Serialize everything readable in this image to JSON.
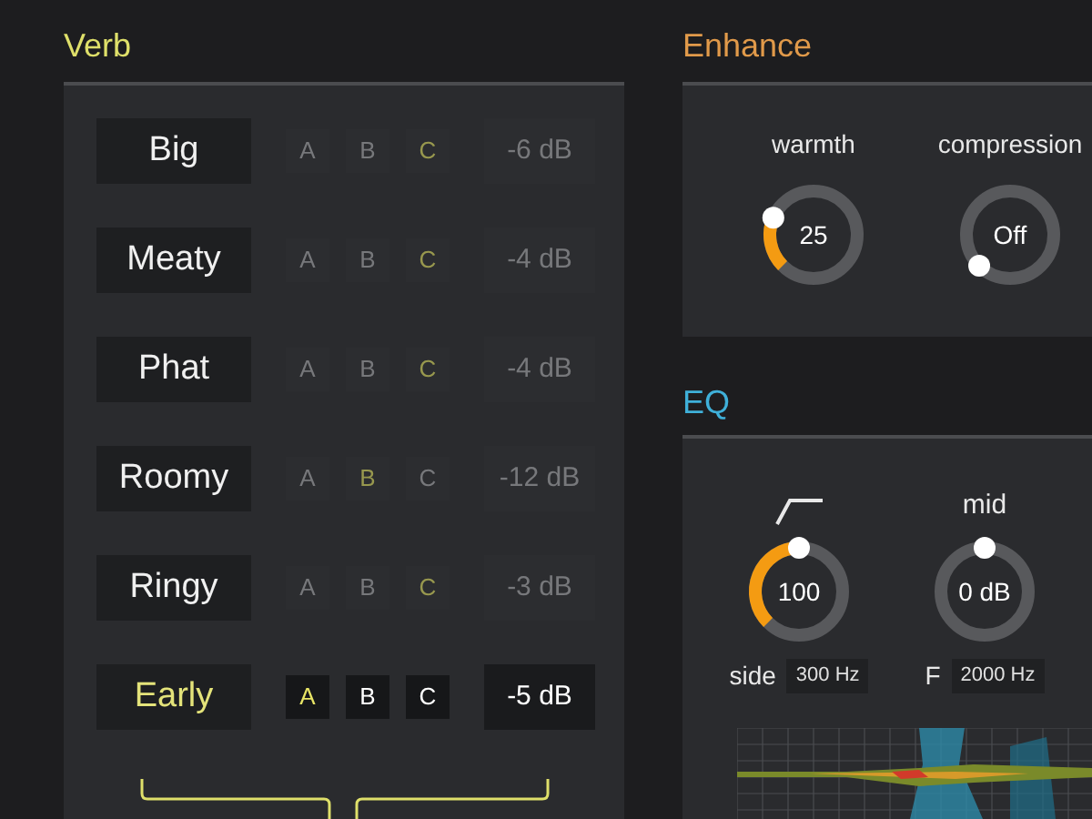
{
  "verb": {
    "title": "Verb",
    "rows": [
      {
        "name": "Big",
        "active": false,
        "options": [
          {
            "label": "A",
            "selected": false
          },
          {
            "label": "B",
            "selected": false
          },
          {
            "label": "C",
            "selected": true
          }
        ],
        "gain": "-6 dB"
      },
      {
        "name": "Meaty",
        "active": false,
        "options": [
          {
            "label": "A",
            "selected": false
          },
          {
            "label": "B",
            "selected": false
          },
          {
            "label": "C",
            "selected": true
          }
        ],
        "gain": "-4 dB"
      },
      {
        "name": "Phat",
        "active": false,
        "options": [
          {
            "label": "A",
            "selected": false
          },
          {
            "label": "B",
            "selected": false
          },
          {
            "label": "C",
            "selected": true
          }
        ],
        "gain": "-4 dB"
      },
      {
        "name": "Roomy",
        "active": false,
        "options": [
          {
            "label": "A",
            "selected": false
          },
          {
            "label": "B",
            "selected": true
          },
          {
            "label": "C",
            "selected": false
          }
        ],
        "gain": "-12 dB"
      },
      {
        "name": "Ringy",
        "active": false,
        "options": [
          {
            "label": "A",
            "selected": false
          },
          {
            "label": "B",
            "selected": false
          },
          {
            "label": "C",
            "selected": true
          }
        ],
        "gain": "-3 dB"
      },
      {
        "name": "Early",
        "active": true,
        "options": [
          {
            "label": "A",
            "selected": true
          },
          {
            "label": "B",
            "selected": false
          },
          {
            "label": "C",
            "selected": false
          }
        ],
        "gain": "-5 dB"
      }
    ]
  },
  "enhance": {
    "title": "Enhance",
    "knobs": [
      {
        "label": "warmth",
        "value": "25"
      },
      {
        "label": "compression",
        "value": "Off"
      }
    ]
  },
  "eq": {
    "title": "EQ",
    "knobs": [
      {
        "value": "100",
        "caption": "side",
        "field": "300 Hz"
      },
      {
        "label": "mid",
        "value": "0 dB",
        "caption": "F",
        "field": "2000 Hz"
      }
    ]
  }
}
